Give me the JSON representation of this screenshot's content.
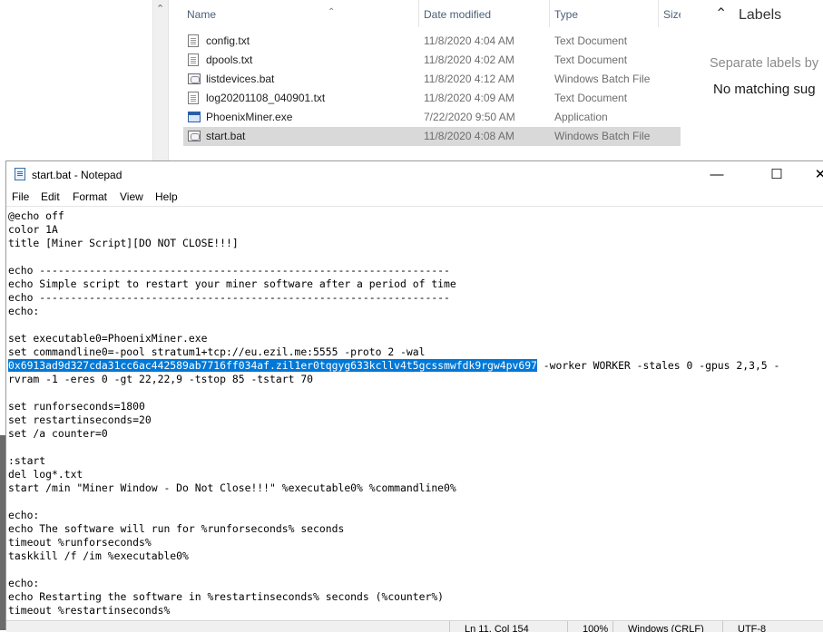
{
  "explorer": {
    "columns": {
      "name": "Name",
      "date": "Date modified",
      "type": "Type",
      "size": "Size"
    },
    "files": [
      {
        "name": "config.txt",
        "date": "11/8/2020 4:04 AM",
        "type": "Text Document",
        "icon": "text-file-icon"
      },
      {
        "name": "dpools.txt",
        "date": "11/8/2020 4:02 AM",
        "type": "Text Document",
        "icon": "text-file-icon"
      },
      {
        "name": "listdevices.bat",
        "date": "11/8/2020 4:12 AM",
        "type": "Windows Batch File",
        "icon": "batch-file-icon"
      },
      {
        "name": "log20201108_040901.txt",
        "date": "11/8/2020 4:09 AM",
        "type": "Text Document",
        "icon": "text-file-icon"
      },
      {
        "name": "PhoenixMiner.exe",
        "date": "7/22/2020 9:50 AM",
        "type": "Application",
        "icon": "application-icon"
      },
      {
        "name": "start.bat",
        "date": "11/8/2020 4:08 AM",
        "type": "Windows Batch File",
        "icon": "batch-file-icon",
        "selected": true
      }
    ]
  },
  "labels_pane": {
    "title": "Labels",
    "placeholder": "Separate labels by",
    "no_match": "No matching sug"
  },
  "notepad": {
    "title": "start.bat - Notepad",
    "menu": [
      "File",
      "Edit",
      "Format",
      "View",
      "Help"
    ],
    "lines": [
      "@echo off",
      "color 1A",
      "title [Miner Script][DO NOT CLOSE!!!]",
      "",
      "echo ------------------------------------------------------------------",
      "echo Simple script to restart your miner software after a period of time",
      "echo ------------------------------------------------------------------",
      "echo:",
      "",
      "set executable0=PhoenixMiner.exe",
      "set commandline0=-pool stratum1+tcp://eu.ezil.me:5555 -proto 2 -wal",
      "",
      "rvram -1 -eres 0 -gt 22,22,9 -tstop 85 -tstart 70",
      "",
      "set runforseconds=1800",
      "set restartinseconds=20",
      "set /a counter=0",
      "",
      ":start",
      "del log*.txt",
      "start /min \"Miner Window - Do Not Close!!!\" %executable0% %commandline0%",
      "",
      "echo:",
      "echo The software will run for %runforseconds% seconds",
      "timeout %runforseconds%",
      "taskkill /f /im %executable0%",
      "",
      "echo:",
      "echo Restarting the software in %restartinseconds% seconds (%counter%)",
      "timeout %restartinseconds%"
    ],
    "selected_text": "0x6913ad9d327cda31cc6ac442589ab7716ff034af.zil1er0tqgyg633kcllv4t5gcssmwfdk9rgw4pv697",
    "after_selection": " -worker WORKER -stales 0 -gpus 2,3,5 -",
    "status": {
      "position": "Ln 11, Col 154",
      "zoom": "100%",
      "line_ending": "Windows (CRLF)",
      "encoding": "UTF-8"
    }
  },
  "colors": {
    "selection": "#0078d7",
    "explorer_header": "#4c607a",
    "selected_row": "#d9d9d9"
  }
}
